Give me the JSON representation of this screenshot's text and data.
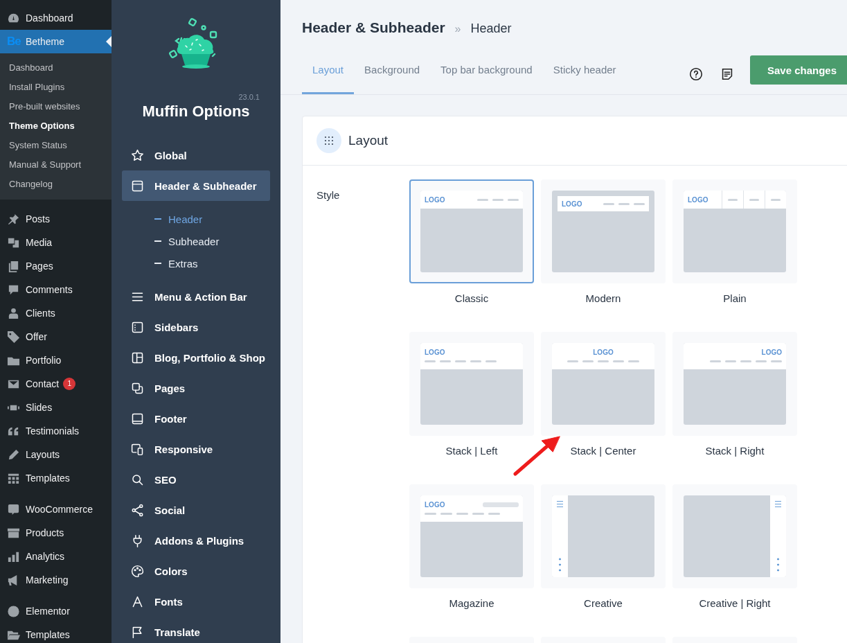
{
  "admin_menu": {
    "groups": [
      {
        "items": [
          {
            "label": "Dashboard",
            "selected": false
          },
          {
            "label": "Betheme",
            "logo": "Be",
            "selected": true,
            "children": [
              {
                "label": "Dashboard",
                "selected": false
              },
              {
                "label": "Install Plugins",
                "selected": false
              },
              {
                "label": "Pre-built websites",
                "selected": false
              },
              {
                "label": "Theme Options",
                "selected": true
              },
              {
                "label": "System Status",
                "selected": false
              },
              {
                "label": "Manual & Support",
                "selected": false
              },
              {
                "label": "Changelog",
                "selected": false
              }
            ]
          }
        ]
      },
      {
        "items": [
          {
            "label": "Posts",
            "selected": false
          },
          {
            "label": "Media",
            "selected": false
          },
          {
            "label": "Pages",
            "selected": false
          },
          {
            "label": "Comments",
            "selected": false
          },
          {
            "label": "Clients",
            "selected": false
          },
          {
            "label": "Offer",
            "selected": false
          },
          {
            "label": "Portfolio",
            "selected": false
          },
          {
            "label": "Contact",
            "badge": "1",
            "selected": false
          },
          {
            "label": "Slides",
            "selected": false
          },
          {
            "label": "Testimonials",
            "selected": false
          },
          {
            "label": "Layouts",
            "selected": false
          },
          {
            "label": "Templates",
            "selected": false
          }
        ]
      },
      {
        "items": [
          {
            "label": "WooCommerce",
            "selected": false
          },
          {
            "label": "Products",
            "selected": false
          },
          {
            "label": "Analytics",
            "selected": false
          },
          {
            "label": "Marketing",
            "selected": false
          }
        ]
      },
      {
        "items": [
          {
            "label": "Elementor",
            "selected": false
          },
          {
            "label": "Templates",
            "selected": false
          }
        ]
      }
    ]
  },
  "options_panel": {
    "version": "23.0.1",
    "title": "Muffin Options",
    "nav": [
      {
        "label": "Global",
        "selected": false
      },
      {
        "label": "Header & Subheader",
        "selected": true,
        "children": [
          {
            "label": "Header",
            "selected": true
          },
          {
            "label": "Subheader",
            "selected": false
          },
          {
            "label": "Extras",
            "selected": false
          }
        ]
      },
      {
        "label": "Menu & Action Bar",
        "selected": false
      },
      {
        "label": "Sidebars",
        "selected": false
      },
      {
        "label": "Blog, Portfolio & Shop",
        "selected": false
      },
      {
        "label": "Pages",
        "selected": false
      },
      {
        "label": "Footer",
        "selected": false
      },
      {
        "label": "Responsive",
        "selected": false
      },
      {
        "label": "SEO",
        "selected": false
      },
      {
        "label": "Social",
        "selected": false
      },
      {
        "label": "Addons & Plugins",
        "selected": false
      },
      {
        "label": "Colors",
        "selected": false
      },
      {
        "label": "Fonts",
        "selected": false
      },
      {
        "label": "Translate",
        "selected": false
      }
    ]
  },
  "page": {
    "title": "Header & Subheader",
    "separator": "»",
    "current": "Header"
  },
  "tabs": [
    {
      "label": "Layout",
      "selected": true
    },
    {
      "label": "Background",
      "selected": false
    },
    {
      "label": "Top bar background",
      "selected": false
    },
    {
      "label": "Sticky header",
      "selected": false
    }
  ],
  "save_button": "Save changes",
  "section": {
    "title": "Layout",
    "field_label": "Style",
    "options": [
      {
        "kind": "classic",
        "logo": "LOGO",
        "label": "Classic",
        "selected": true
      },
      {
        "kind": "modern",
        "logo": "LOGO",
        "label": "Modern",
        "selected": false
      },
      {
        "kind": "plain",
        "logo": "LOGO",
        "label": "Plain",
        "selected": false
      },
      {
        "kind": "stack-left",
        "logo": "LOGO",
        "label": "Stack | Left",
        "selected": false
      },
      {
        "kind": "stack-center",
        "logo": "LOGO",
        "label": "Stack | Center",
        "selected": false
      },
      {
        "kind": "stack-right",
        "logo": "LOGO",
        "label": "Stack | Right",
        "selected": false
      },
      {
        "kind": "magazine",
        "logo": "LOGO",
        "label": "Magazine",
        "selected": false
      },
      {
        "kind": "creative",
        "label": "Creative",
        "selected": false
      },
      {
        "kind": "creative-right",
        "label": "Creative | Right",
        "selected": false
      },
      {
        "kind": "blank",
        "selected": false
      },
      {
        "kind": "blank",
        "selected": false
      },
      {
        "kind": "blank",
        "selected": false
      }
    ]
  }
}
